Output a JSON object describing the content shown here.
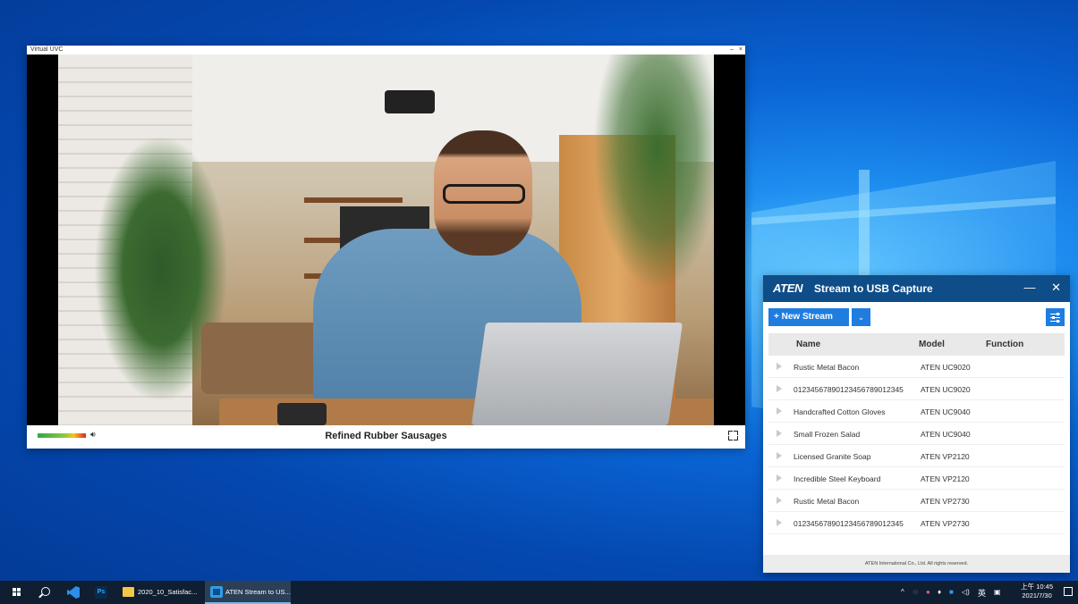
{
  "uvc_window": {
    "title": "Virtual UVC",
    "minimize": "–",
    "close": "×",
    "stream_name": "Refined Rubber Sausages",
    "volume_icon": "speaker-icon",
    "fullscreen_icon": "fullscreen-icon"
  },
  "aten_window": {
    "logo": "ATEN",
    "title": "Stream to USB Capture",
    "minimize": "—",
    "close": "✕",
    "new_stream_label": "+ New Stream",
    "dropdown_icon": "chevron-down-icon",
    "settings_icon": "sliders-icon",
    "columns": [
      "Name",
      "Model",
      "Function"
    ],
    "rows": [
      {
        "name": "Rustic Metal Bacon",
        "model": "ATEN UC9020",
        "function": ""
      },
      {
        "name": "01234567890123456789012345",
        "model": "ATEN UC9020",
        "function": ""
      },
      {
        "name": "Handcrafted Cotton Gloves",
        "model": "ATEN UC9040",
        "function": ""
      },
      {
        "name": "Small Frozen Salad",
        "model": "ATEN UC9040",
        "function": ""
      },
      {
        "name": "Licensed Granite Soap",
        "model": "ATEN VP2120",
        "function": ""
      },
      {
        "name": "Incredible Steel Keyboard",
        "model": "ATEN VP2120",
        "function": ""
      },
      {
        "name": "Rustic Metal Bacon",
        "model": "ATEN VP2730",
        "function": ""
      },
      {
        "name": "01234567890123456789012345",
        "model": "ATEN VP2730",
        "function": ""
      }
    ],
    "footer": "ATEN International Co., Ltd. All rights reserved."
  },
  "taskbar": {
    "ps_label": "Ps",
    "folder_task_label": "2020_10_Satisfac...",
    "aten_task_label": "ATEN Stream to US...",
    "tray_chevron": "^",
    "ime": "英",
    "time": "上午 10:45",
    "date": "2021/7/30",
    "colors": {
      "taskbar": "#0f1e30",
      "accent": "#1f7de0",
      "aten_title": "#0e4d88"
    }
  }
}
